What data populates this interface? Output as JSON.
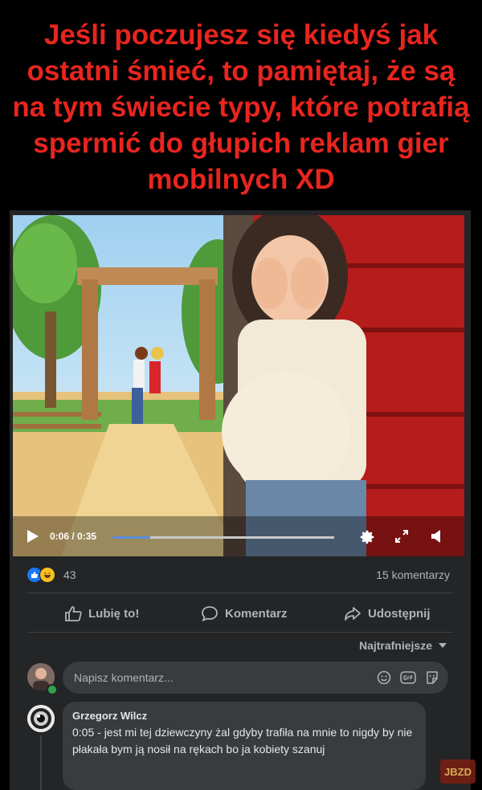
{
  "caption": "Jeśli poczujesz się kiedyś jak ostatni śmieć, to pamiętaj, że są na tym świecie typy, które potrafią spermić do głupich reklam gier mobilnych XD",
  "video": {
    "current_time": "0:06",
    "duration": "0:35",
    "time_label": "0:06 / 0:35",
    "progress_fraction": 0.171,
    "icons": [
      "play-icon",
      "settings-icon",
      "expand-icon",
      "volume-icon"
    ]
  },
  "reactions": {
    "icons": [
      "like-reaction-icon",
      "haha-reaction-icon"
    ],
    "count": "43",
    "comments": "15 komentarzy"
  },
  "actions": {
    "like": "Lubię to!",
    "comment": "Komentarz",
    "share": "Udostępnij"
  },
  "sort_label": "Najtrafniejsze",
  "composer": {
    "placeholder": "Napisz komentarz...",
    "icons": [
      "emoji-icon",
      "gif-icon",
      "sticker-icon"
    ]
  },
  "comment": {
    "author": "Grzegorz Wilcz",
    "text": "0:05 - jest mi tej dziewczyny żal gdyby trafiła na mnie to nigdy by nie płakała bym ją nosił na rękach bo ja kobiety szanuj"
  },
  "watermark": "JBZD",
  "colors": {
    "caption": "#e8251f",
    "post_bg": "#242526",
    "accent": "#1877f2",
    "online": "#31a24c"
  }
}
